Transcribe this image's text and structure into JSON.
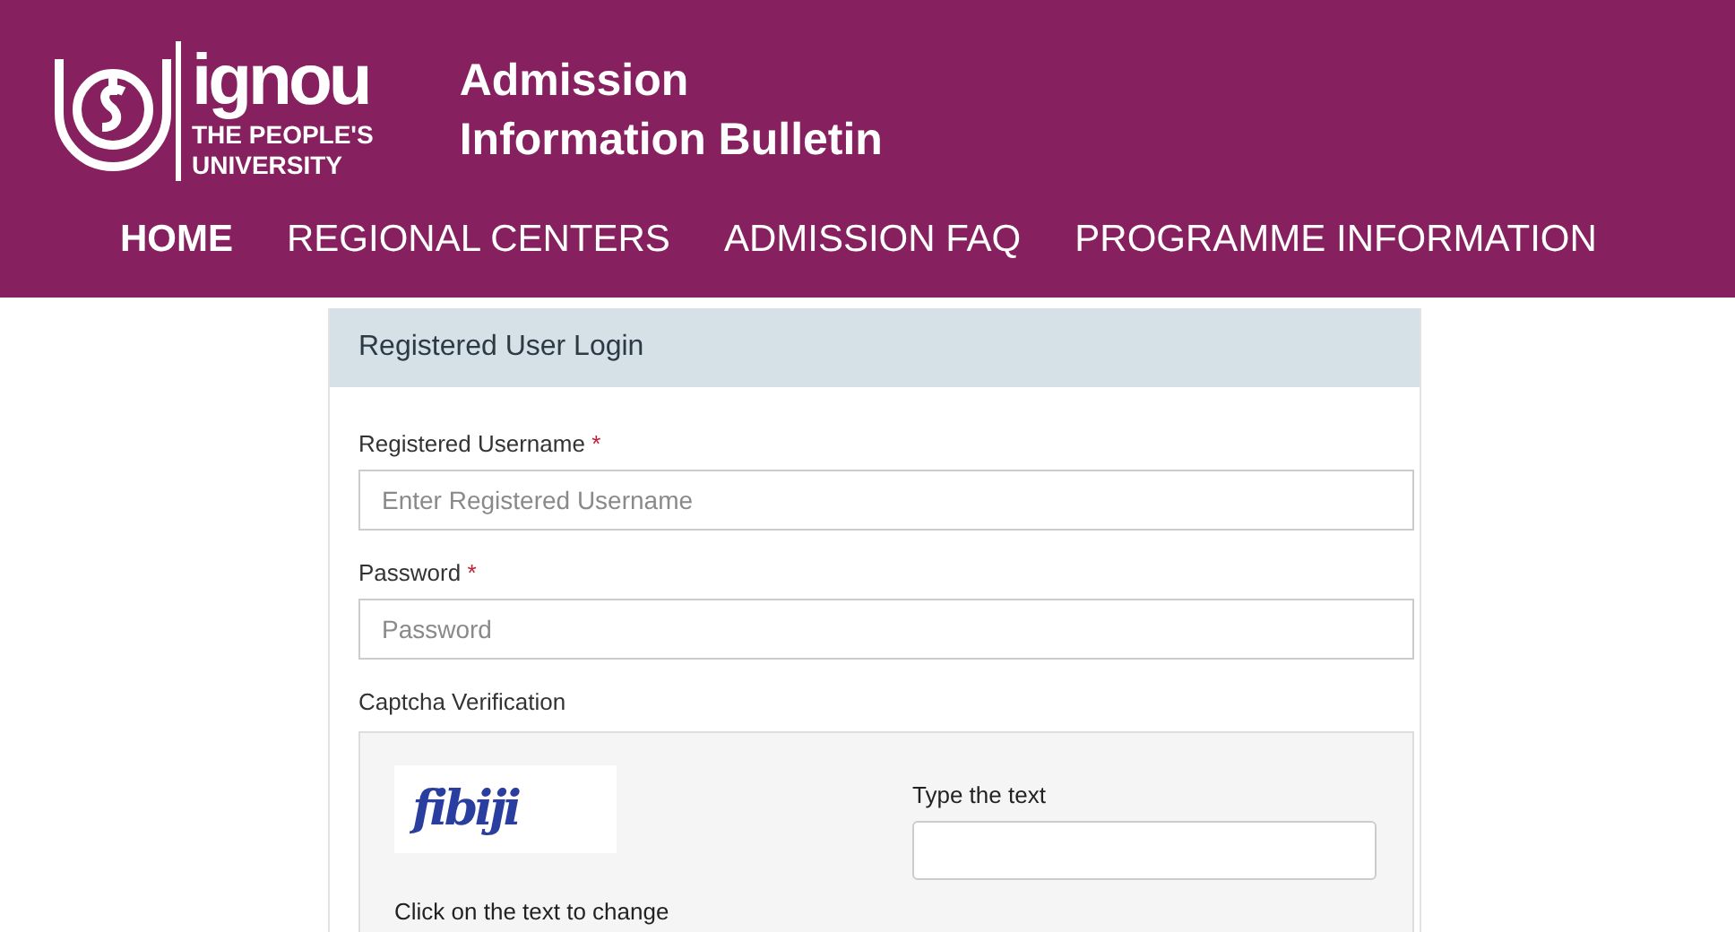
{
  "header": {
    "logo": {
      "wordmark": "ignou",
      "tagline_1": "THE PEOPLE'S",
      "tagline_2": "UNIVERSITY"
    },
    "title_1": "Admission",
    "title_2": "Information Bulletin"
  },
  "nav": [
    {
      "label": "HOME",
      "selected": true
    },
    {
      "label": "REGIONAL CENTERS",
      "selected": false
    },
    {
      "label": "ADMISSION FAQ",
      "selected": false
    },
    {
      "label": "PROGRAMME INFORMATION",
      "selected": false
    }
  ],
  "login": {
    "title": "Registered User Login",
    "fields": [
      {
        "label": "Registered Username",
        "required_mark": "*",
        "placeholder": "Enter Registered Username"
      },
      {
        "label": "Password",
        "required_mark": "*",
        "placeholder": "Password"
      }
    ],
    "captcha": {
      "label": "Captcha Verification",
      "captcha_text": "fibiji",
      "hint": "Click on the text to change",
      "input_label": "Type the text"
    }
  }
}
